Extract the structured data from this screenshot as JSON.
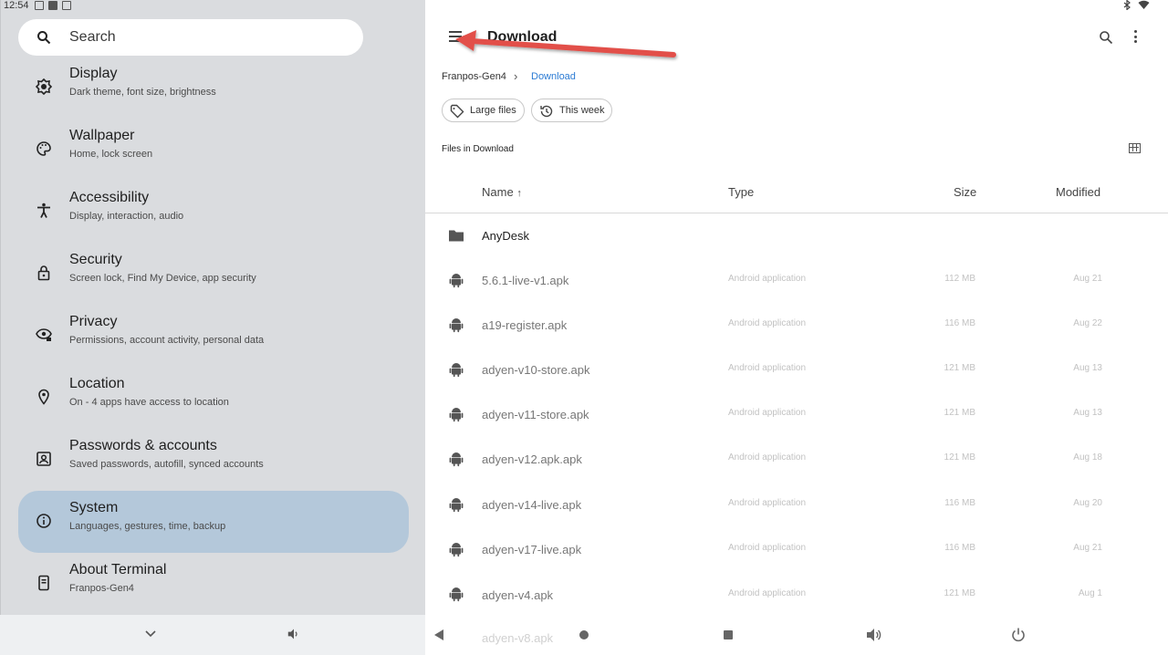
{
  "status": {
    "time": "12:54"
  },
  "settings": {
    "search_label": "Search",
    "items": [
      {
        "title": "Display",
        "subtitle": "Dark theme, font size, brightness",
        "icon": "brightness-icon"
      },
      {
        "title": "Wallpaper",
        "subtitle": "Home, lock screen",
        "icon": "palette-icon"
      },
      {
        "title": "Accessibility",
        "subtitle": "Display, interaction, audio",
        "icon": "accessibility-icon"
      },
      {
        "title": "Security",
        "subtitle": "Screen lock, Find My Device, app security",
        "icon": "lock-icon"
      },
      {
        "title": "Privacy",
        "subtitle": "Permissions, account activity, personal data",
        "icon": "eye-lock-icon"
      },
      {
        "title": "Location",
        "subtitle": "On - 4 apps have access to location",
        "icon": "location-pin-icon"
      },
      {
        "title": "Passwords & accounts",
        "subtitle": "Saved passwords, autofill, synced accounts",
        "icon": "account-box-icon"
      },
      {
        "title": "System",
        "subtitle": "Languages, gestures, time, backup",
        "icon": "info-icon"
      },
      {
        "title": "About Terminal",
        "subtitle": "Franpos-Gen4",
        "icon": "phone-icon"
      }
    ]
  },
  "files": {
    "title": "Download",
    "breadcrumb": {
      "root": "Franpos-Gen4",
      "current": "Download"
    },
    "chips": {
      "large_files": "Large files",
      "this_week": "This week"
    },
    "section_title": "Files in Download",
    "columns": {
      "name": "Name",
      "sort_indicator": "↑",
      "type": "Type",
      "size": "Size",
      "modified": "Modified"
    },
    "rows": [
      {
        "name": "AnyDesk",
        "type": "",
        "size": "",
        "modified": "",
        "kind": "folder"
      },
      {
        "name": "5.6.1-live-v1.apk",
        "type": "Android application",
        "size": "112 MB",
        "modified": "Aug 21",
        "kind": "apk"
      },
      {
        "name": "a19-register.apk",
        "type": "Android application",
        "size": "116 MB",
        "modified": "Aug 22",
        "kind": "apk"
      },
      {
        "name": "adyen-v10-store.apk",
        "type": "Android application",
        "size": "121 MB",
        "modified": "Aug 13",
        "kind": "apk"
      },
      {
        "name": "adyen-v11-store.apk",
        "type": "Android application",
        "size": "121 MB",
        "modified": "Aug 13",
        "kind": "apk"
      },
      {
        "name": "adyen-v12.apk.apk",
        "type": "Android application",
        "size": "121 MB",
        "modified": "Aug 18",
        "kind": "apk"
      },
      {
        "name": "adyen-v14-live.apk",
        "type": "Android application",
        "size": "116 MB",
        "modified": "Aug 20",
        "kind": "apk"
      },
      {
        "name": "adyen-v17-live.apk",
        "type": "Android application",
        "size": "116 MB",
        "modified": "Aug 21",
        "kind": "apk"
      },
      {
        "name": "adyen-v4.apk",
        "type": "Android application",
        "size": "121 MB",
        "modified": "Aug 1",
        "kind": "apk"
      }
    ],
    "partial_row_name": "adyen-v8.apk"
  },
  "colors": {
    "active_item": "#b4c8da",
    "link": "#2b7bd4",
    "arrow": "#e2504a"
  }
}
